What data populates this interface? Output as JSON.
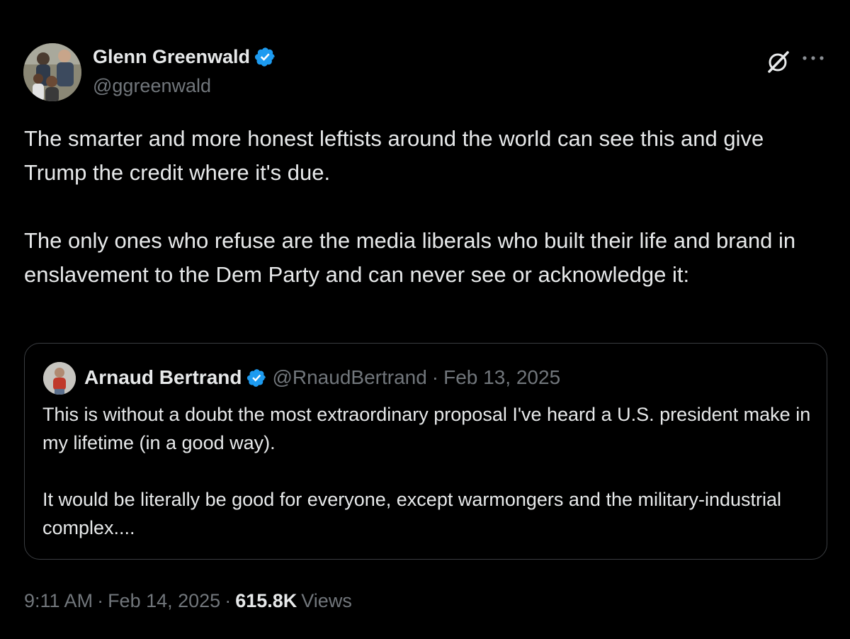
{
  "post": {
    "author": {
      "name": "Glenn Greenwald",
      "handle": "@ggreenwald"
    },
    "body": [
      "The smarter and more honest leftists around the world can see this and give Trump the credit where it's due.",
      "The only ones who refuse are the media liberals who built their life and brand in enslavement to the Dem Party and can never see or acknowledge it:"
    ],
    "quote": {
      "name": "Arnaud Bertrand",
      "handle": "@RnaudBertrand",
      "separator": "·",
      "date": "Feb 13, 2025",
      "body": [
        "This is without a doubt the most extraordinary proposal I've heard a U.S. president make in my lifetime (in a good way).",
        "It would be literally be good for everyone, except warmongers and the military-industrial complex...."
      ]
    },
    "meta": {
      "time": "9:11 AM",
      "separator": "·",
      "date": "Feb 14, 2025",
      "views_count": "615.8K",
      "views_label": "Views"
    }
  },
  "icons": {
    "verified": "verified-badge-icon",
    "grok": "grok-icon",
    "more": "more-options-icon"
  },
  "colors": {
    "background": "#000000",
    "text_primary": "#e7e9ea",
    "text_secondary": "#71767b",
    "verified_blue": "#1d9bf0",
    "quote_border": "#3a3d41"
  }
}
